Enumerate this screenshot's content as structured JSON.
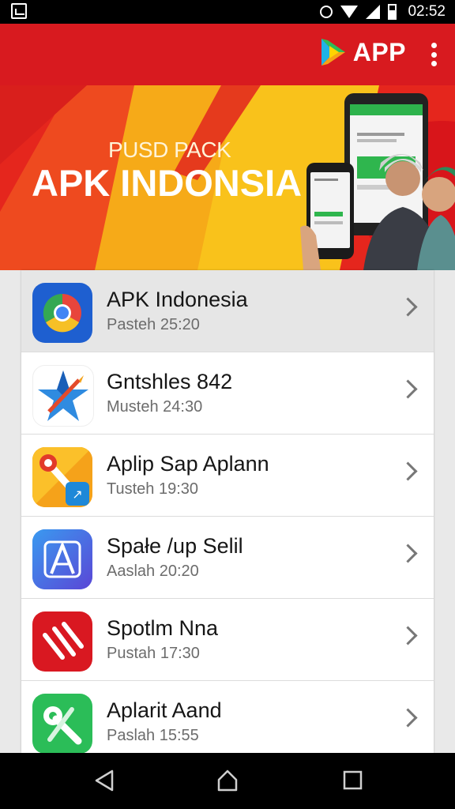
{
  "status_bar": {
    "time": "02:52"
  },
  "app_bar": {
    "brand": "APP"
  },
  "banner": {
    "subtitle": "PUSD PACK",
    "title": "APK INDONSIA"
  },
  "apps": [
    {
      "name": "APK Indonesia",
      "time": "Pasteh 25:20",
      "icon": "chrome-icon"
    },
    {
      "name": "Gntshles 842",
      "time": "Musteh 24:30",
      "icon": "star-pen-icon"
    },
    {
      "name": "Aplip Sap Aplann",
      "time": "Tusteh 19:30",
      "icon": "pin-icon"
    },
    {
      "name": "Spałe /up Selil",
      "time": "Aaslah 20:20",
      "icon": "app-store-icon"
    },
    {
      "name": "Spotlm Nna",
      "time": "Pustah 17:30",
      "icon": "stripes-icon"
    },
    {
      "name": "Aplarit Aand",
      "time": "Paslah 15:55",
      "icon": "tool-icon"
    }
  ],
  "colors": {
    "app_bar": "#d81a1f",
    "banner_yellow": "#f7b718",
    "nav_bar": "#000000"
  }
}
